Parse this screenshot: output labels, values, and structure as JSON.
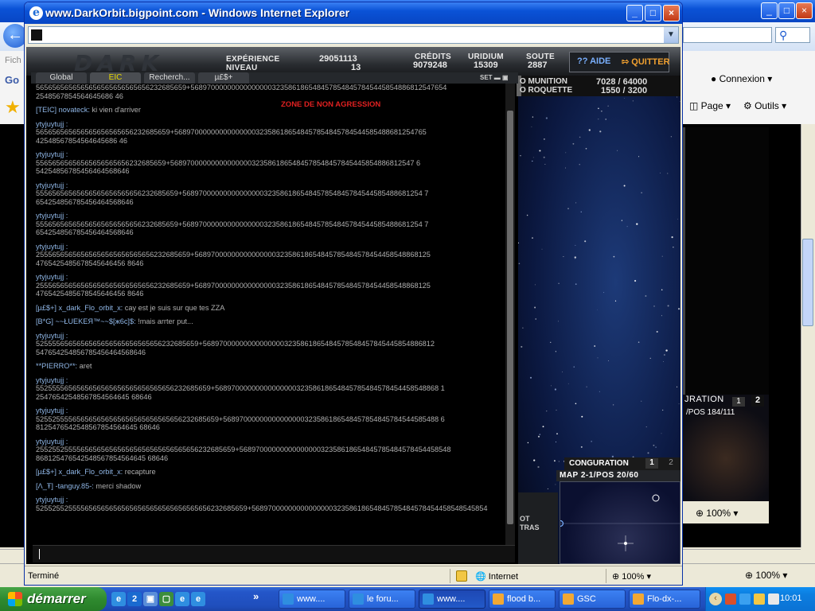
{
  "background_window": {
    "title_buttons": [
      "_",
      "□",
      "×"
    ],
    "left_menu_hint": "Fich",
    "left_link_hint": "Go",
    "connexion": "Connexion",
    "page_menu": "Page",
    "outils_menu": "Outils",
    "zoom": "100%",
    "zoom2": "100%",
    "minimap_title": "JRATION",
    "minimap_pos": "/POS 184/111",
    "minimap_n1": "1",
    "minimap_n2": "2"
  },
  "window": {
    "title": "www.DarkOrbit.bigpoint.com - Windows Internet Explorer",
    "status": "Terminé",
    "zone": "Internet",
    "zoom": "100%"
  },
  "hud": {
    "experience_label": "EXPÉRIENCE",
    "experience_value": "29051113",
    "niveau_label": "NIVEAU",
    "niveau_value": "13",
    "credits_label": "CRÉDITS",
    "credits_value": "9079248",
    "uridium_label": "URIDIUM",
    "uridium_value": "15309",
    "soute_label": "SOUTE",
    "soute_value": "2887",
    "aide": "?? AIDE",
    "quitter": "QUITTER",
    "munition_label": "O MUNITION",
    "munition_value": "7028 / 64000",
    "roquette_label": "O ROQUETTE",
    "roquette_value": "1550 / 3200",
    "zone_notice": "ZONE DE NON AGRESSION"
  },
  "chat": {
    "tabs": [
      "Global",
      "EIC",
      "Recherch...",
      "µ£$+"
    ],
    "set_label": "SET",
    "lines": [
      {
        "name": "",
        "text": "5656565656565656565656565656232685659+568970000000000000003235861865484578548457845445854886812547654"
      },
      {
        "name": "",
        "text": "2548567854564645686 46"
      },
      {
        "name": "[TEIC] novateck:",
        "text": " ki vien d'arriver",
        "gap": true
      },
      {
        "name": "ytyjuytujj :",
        "text": "",
        "gap": true
      },
      {
        "name": "",
        "text": "565656565656565656565656232685659+56897000000000000000323586186548457854845784544585488681254765"
      },
      {
        "name": "",
        "text": "42548567854564645686 46"
      },
      {
        "name": "ytyjuytujj :",
        "text": "",
        "gap": true
      },
      {
        "name": "",
        "text": "55656565656565656565656232685659+568970000000000000003235861865484578548457845445854886812547 6"
      },
      {
        "name": "",
        "text": "54254856785456464568646"
      },
      {
        "name": "ytyjuytujj :",
        "text": "",
        "gap": true
      },
      {
        "name": "",
        "text": "55565656565656565656565656232685659+56897000000000000000323586186548457854845784544585488681254 7"
      },
      {
        "name": "",
        "text": "654254856785456464568646"
      },
      {
        "name": "ytyjuytujj :",
        "text": "",
        "gap": true
      },
      {
        "name": "",
        "text": "55565656565656565656565656232685659+56897000000000000000323586186548457854845784544585488681254 7"
      },
      {
        "name": "",
        "text": "654254856785456464568646"
      },
      {
        "name": "ytyjuytujj :",
        "text": "",
        "gap": true
      },
      {
        "name": "",
        "text": "25556565656565656565656565656232685659+5689700000000000000032358618654845785484578454458548868125"
      },
      {
        "name": "",
        "text": "4765425485678545646456 8646"
      },
      {
        "name": "ytyjuytujj :",
        "text": "",
        "gap": true
      },
      {
        "name": "",
        "text": "25556565656565656565656565656232685659+5689700000000000000032358618654845785484578454458548868125"
      },
      {
        "name": "",
        "text": "4765425485678545646456 8646"
      },
      {
        "name": "[µ£$+] x_dark_Flo_orbit_x:",
        "text": " cay est je suis sur que tes ZZA",
        "gap": true
      },
      {
        "name": "[B*G] ~~ŁUEKEЯ™~~$[ж6c]$:",
        "text": " !mais arrter put...",
        "gap": true
      },
      {
        "name": "ytyjuytujj :",
        "text": "",
        "gap": true
      },
      {
        "name": "",
        "text": "5255556565656565656565656565656232685659+568970000000000000003235861865484578548457845445854886812"
      },
      {
        "name": "",
        "text": "547654254856785456464568646"
      },
      {
        "name": "**PIERRO**:",
        "text": " aret",
        "gap": true
      },
      {
        "name": "ytyjuytujj :",
        "text": "",
        "gap": true
      },
      {
        "name": "",
        "text": "5525555656565656565656565656565656232685659+5689700000000000000032358618654845785484578454458548868 1"
      },
      {
        "name": "",
        "text": "25476542548567854564645 68646"
      },
      {
        "name": "ytyjuytujj :",
        "text": "",
        "gap": true
      },
      {
        "name": "",
        "text": "525525555656565656565656565656565656232685659+56897000000000000000323586186548457854845784544585488 6"
      },
      {
        "name": "",
        "text": "8125476542548567854564645 68646"
      },
      {
        "name": "ytyjuytujj :",
        "text": "",
        "gap": true
      },
      {
        "name": "",
        "text": "2552552555565656565656565656565656565656232685659+5689700000000000000032358618654845785484578454458548"
      },
      {
        "name": "",
        "text": "868125476542548567854564645 68646"
      },
      {
        "name": "[µ£$+] x_dark_Flo_orbit_x:",
        "text": " recapture",
        "gap": true
      },
      {
        "name": "[Λ_Ŧ] -tanguy.85-:",
        "text": " merci shadow",
        "gap": true
      },
      {
        "name": "ytyjuytujj :",
        "text": "",
        "gap": true
      },
      {
        "name": "",
        "text": "5255255255556565656565656565656565656565656232685659+5689700000000000000032358618654845785484578454458548545854"
      }
    ]
  },
  "minimap": {
    "title": "CONGURATION",
    "n1": "1",
    "n2": "2",
    "pos": "MAP 2-1/POS 20/60",
    "left_label": "OT\nTRAS"
  },
  "taskbar": {
    "start": "démarrer",
    "quicklaunch": [
      "e",
      "2",
      "▣",
      "▢",
      "e",
      "e"
    ],
    "buttons": [
      {
        "label": "www....",
        "active": false
      },
      {
        "label": "le foru...",
        "active": false
      },
      {
        "label": "www....",
        "active": true
      },
      {
        "label": "flood b...",
        "active": false
      },
      {
        "label": "GSC",
        "active": false
      },
      {
        "label": "Flo-dx-...",
        "active": false
      }
    ],
    "clock": "10:01"
  }
}
